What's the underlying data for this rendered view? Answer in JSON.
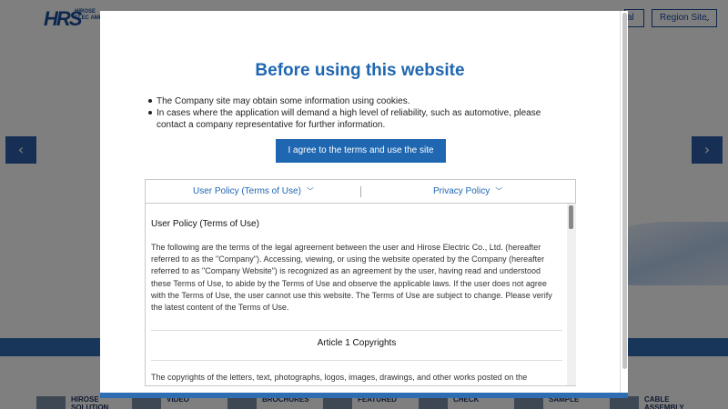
{
  "background": {
    "logo_mark": "HRS",
    "logo_text": "HIROSE ELEC AME",
    "header_global_label": "al",
    "header_region_label": "Region Site",
    "prev_arrow": "‹",
    "next_arrow": "›",
    "cards": [
      {
        "label": "HIROSE SOLUTION"
      },
      {
        "label": "VIDEO"
      },
      {
        "label": "BROCHURES"
      },
      {
        "label": "FEATURED"
      },
      {
        "label": "CHECK"
      },
      {
        "label": "SAMPLE"
      },
      {
        "label": "CABLE ASSEMBLY"
      }
    ]
  },
  "modal": {
    "title": "Before using this website",
    "notes": [
      "The Company site may obtain some information using cookies.",
      "In cases where the application will demand a high level of reliability, such as automotive, please contact a company representative for further information."
    ],
    "agree_button": "I agree to the terms and use the site",
    "tabs": [
      {
        "label": "User Policy (Terms of Use)"
      },
      {
        "label": "Privacy Policy"
      }
    ],
    "policy": {
      "heading": "User Policy (Terms of Use)",
      "paragraph": "The following are the terms of the legal agreement between the user and Hirose Electric Co., Ltd. (hereafter referred to as the \"Company\"). Accessing, viewing, or using the website operated by the Company (hereafter referred to as \"Company Website\") is recognized as an agreement by the user, having read and understood these Terms of Use, to abide by the Terms of Use and observe the applicable laws. If the user does not agree with the Terms of Use, the user cannot use this website. The Terms of Use are subject to change. Please verify the latest content of the Terms of Use.",
      "article_title": "Article 1 Copyrights",
      "article_paragraph": "The copyrights of the letters, text, photographs, logos, images, drawings, and other works posted on the"
    }
  },
  "colors": {
    "brand_blue": "#1f67b1",
    "band_blue": "#2f6db3"
  }
}
